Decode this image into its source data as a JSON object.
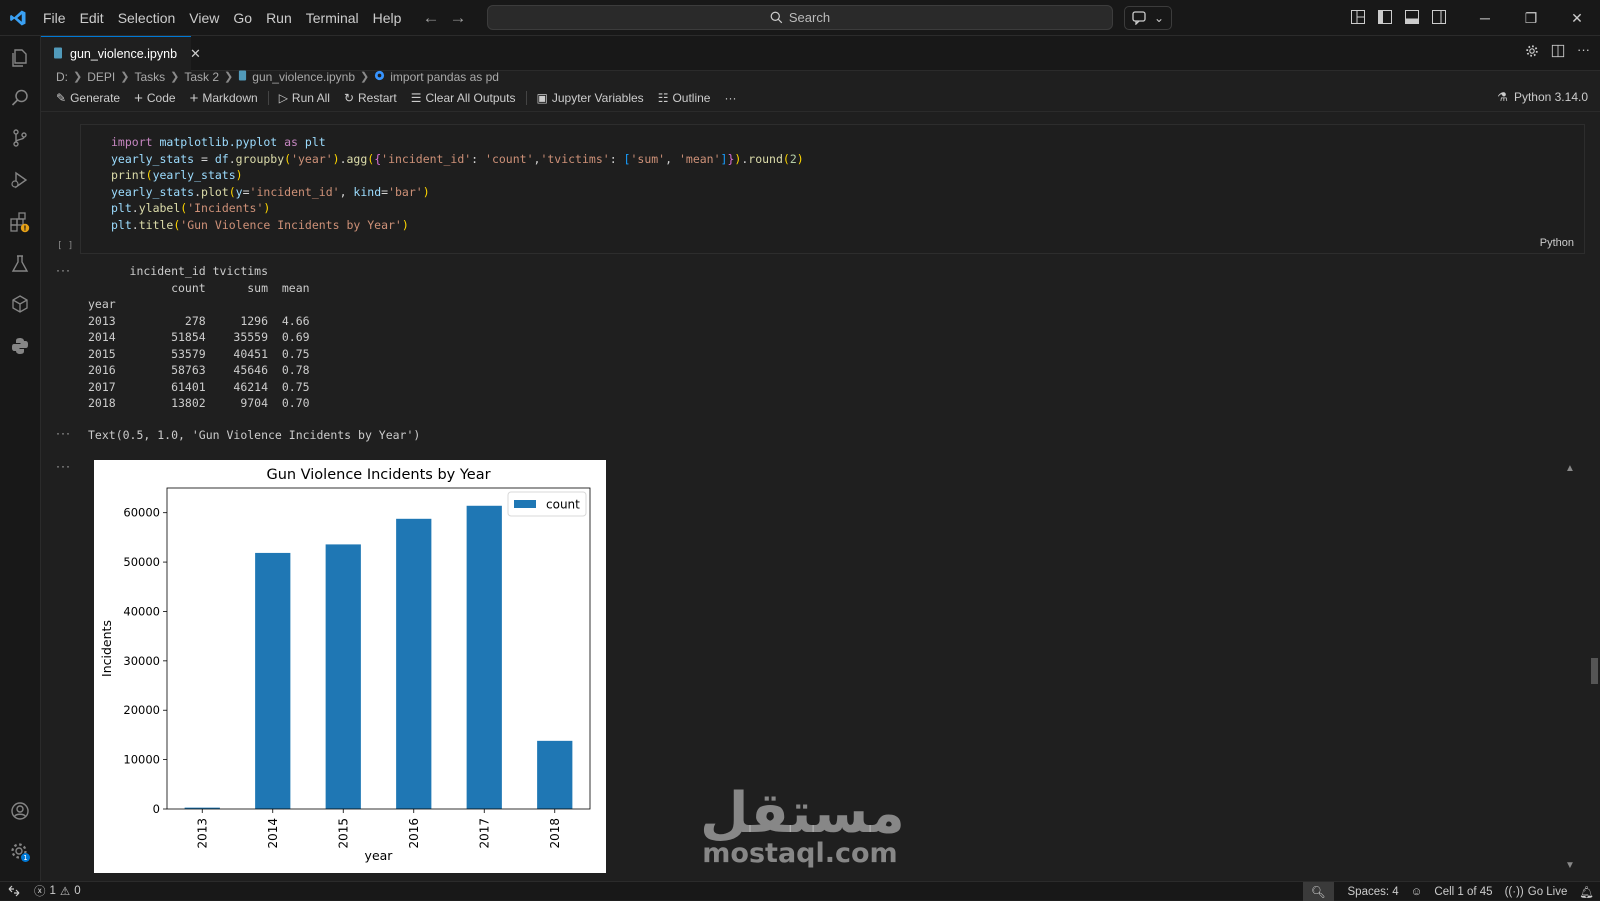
{
  "titlebar": {
    "menu": [
      "File",
      "Edit",
      "Selection",
      "View",
      "Go",
      "Run",
      "Terminal",
      "Help"
    ],
    "search_label": "Search"
  },
  "tab": {
    "filename": "gun_violence.ipynb"
  },
  "breadcrumb": [
    "D:",
    "DEPI",
    "Tasks",
    "Task 2",
    "gun_violence.ipynb",
    "import pandas as pd"
  ],
  "toolbar": {
    "generate": "Generate",
    "code": "Code",
    "markdown": "Markdown",
    "run_all": "Run All",
    "restart": "Restart",
    "clear_outputs": "Clear All Outputs",
    "variables": "Jupyter Variables",
    "outline": "Outline",
    "more": "···",
    "kernel": "Python 3.14.0"
  },
  "cell": {
    "exec_label": "[ ]",
    "language": "Python",
    "code_lines": [
      "import matplotlib.pyplot as plt",
      "yearly_stats = df.groupby('year').agg({'incident_id': 'count','tvictims': ['sum', 'mean']}).round(2)",
      "print(yearly_stats)",
      "yearly_stats.plot(y='incident_id', kind='bar')",
      "plt.ylabel('Incidents')",
      "plt.title('Gun Violence Incidents by Year')"
    ]
  },
  "output": {
    "dots": "···",
    "table_text": "      incident_id tvictims      \n            count      sum  mean\nyear                            \n2013          278     1296  4.66\n2014        51854    35559  0.69\n2015        53579    40451  0.75\n2016        58763    45646  0.78\n2017        61401    46214  0.75\n2018        13802     9704  0.70",
    "repr_text": "Text(0.5, 1.0, 'Gun Violence Incidents by Year')"
  },
  "chart_data": {
    "type": "bar",
    "title": "Gun Violence Incidents by Year",
    "xlabel": "year",
    "ylabel": "Incidents",
    "categories": [
      "2013",
      "2014",
      "2015",
      "2016",
      "2017",
      "2018"
    ],
    "series": [
      {
        "name": "count",
        "values": [
          278,
          51854,
          53579,
          58763,
          61401,
          13802
        ]
      }
    ],
    "ylim": [
      0,
      65000
    ],
    "yticks": [
      0,
      10000,
      20000,
      30000,
      40000,
      50000,
      60000
    ],
    "legend": "top-right",
    "grid": false,
    "bar_color": "#1f77b4"
  },
  "watermark": {
    "arabic": "مستقل",
    "latin": "mostaql.com"
  },
  "statusbar": {
    "errors": "1",
    "warnings": "0",
    "spaces": "Spaces: 4",
    "cell_position": "Cell 1 of 45",
    "go_live": "Go Live"
  },
  "colors": {
    "accent": "#0078d4",
    "background": "#1f1f1f",
    "plot_bar": "#1f77b4"
  }
}
